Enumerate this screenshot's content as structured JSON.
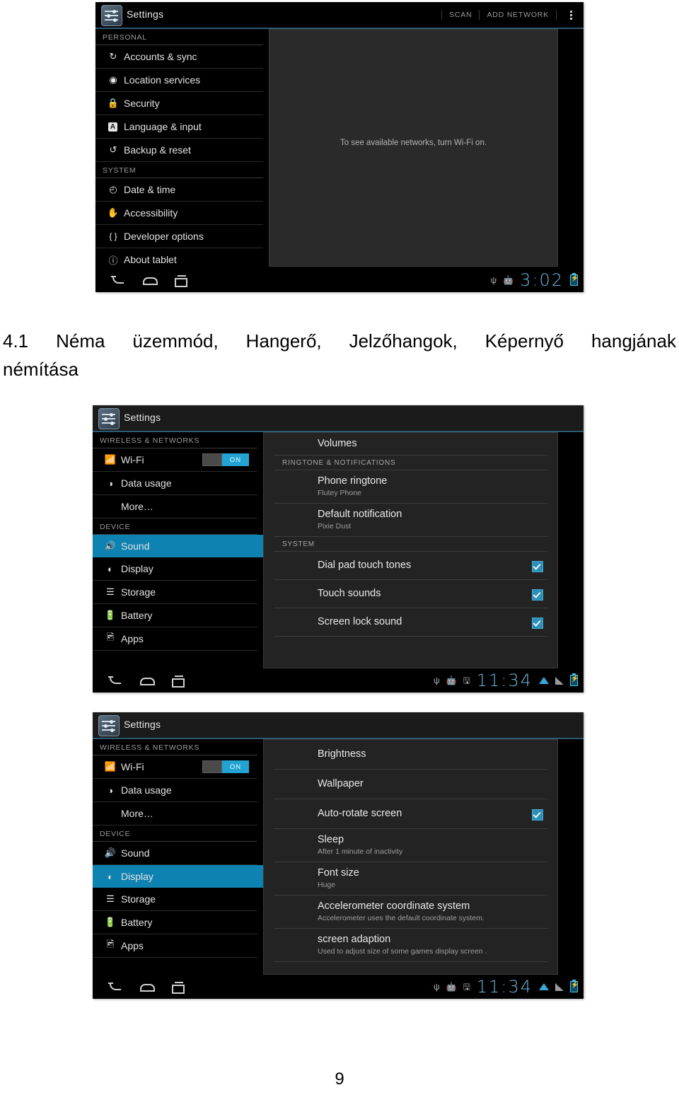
{
  "document": {
    "heading_number": "4.1",
    "heading_words": [
      "Néma",
      "üzemmód,",
      "Hangerő,",
      "Jelzőhangok,",
      "Képernyő",
      "hangjának"
    ],
    "heading_line2": "némítása",
    "page_number": "9"
  },
  "colors": {
    "accent_blue": "#0e82b0",
    "toggle_on": "#22a3d2",
    "checkbox": "#2d8fb8",
    "clock": "#6fb6d8",
    "screen_bg": "#000000",
    "panel_bg": "#232323"
  },
  "screenshot1": {
    "app_title": "Settings",
    "actions": [
      "SCAN",
      "ADD NETWORK"
    ],
    "overflow_icon": "kebab-menu-icon",
    "sidebar": [
      {
        "type": "group",
        "label": "PERSONAL"
      },
      {
        "type": "item",
        "label": "Accounts & sync",
        "icon": "sync-icon",
        "glyph": "↻"
      },
      {
        "type": "item",
        "label": "Location services",
        "icon": "location-icon",
        "glyph": "◉"
      },
      {
        "type": "item",
        "label": "Security",
        "icon": "lock-icon",
        "glyph": "ὑ2"
      },
      {
        "type": "item",
        "label": "Language & input",
        "icon": "language-icon",
        "glyph": "A"
      },
      {
        "type": "item",
        "label": "Backup & reset",
        "icon": "backup-reset-icon",
        "glyph": "↺"
      },
      {
        "type": "group",
        "label": "SYSTEM"
      },
      {
        "type": "item",
        "label": "Date & time",
        "icon": "clock-icon",
        "glyph": "◴"
      },
      {
        "type": "item",
        "label": "Accessibility",
        "icon": "hand-icon",
        "glyph": "✋"
      },
      {
        "type": "item",
        "label": "Developer options",
        "icon": "braces-icon",
        "glyph": "{ }"
      },
      {
        "type": "item",
        "label": "About tablet",
        "icon": "info-icon",
        "glyph": "ⓘ"
      }
    ],
    "content_message": "To see available networks, turn Wi-Fi on.",
    "navbar": {
      "back": "back-icon",
      "home": "home-icon",
      "recents": "recents-icon",
      "usb": "usb-icon",
      "android": "android-debug-icon",
      "clock": "3:02",
      "battery": "battery-charging-icon"
    }
  },
  "screenshot2": {
    "app_title": "Settings",
    "sidebar": [
      {
        "type": "group",
        "label": "WIRELESS & NETWORKS"
      },
      {
        "type": "item",
        "label": "Wi-Fi",
        "icon": "wifi-icon",
        "glyph": "▲",
        "toggle": "ON"
      },
      {
        "type": "item",
        "label": "Data usage",
        "icon": "data-usage-icon",
        "glyph": "◑"
      },
      {
        "type": "item",
        "label": "More…",
        "icon": "",
        "glyph": ""
      },
      {
        "type": "group",
        "label": "DEVICE"
      },
      {
        "type": "item",
        "label": "Sound",
        "icon": "speaker-icon",
        "glyph": "ὐA",
        "selected": true
      },
      {
        "type": "item",
        "label": "Display",
        "icon": "brightness-icon",
        "glyph": "◐"
      },
      {
        "type": "item",
        "label": "Storage",
        "icon": "storage-icon",
        "glyph": "☰"
      },
      {
        "type": "item",
        "label": "Battery",
        "icon": "battery-icon",
        "glyph": "ὐB"
      },
      {
        "type": "item",
        "label": "Apps",
        "icon": "apps-image-icon",
        "glyph": "ὛB"
      }
    ],
    "panel": [
      {
        "type": "row",
        "title": "Volumes"
      },
      {
        "type": "group",
        "label": "RINGTONE & NOTIFICATIONS"
      },
      {
        "type": "row",
        "title": "Phone ringtone",
        "subtitle": "Flutey Phone"
      },
      {
        "type": "row",
        "title": "Default notification",
        "subtitle": "Pixie Dust"
      },
      {
        "type": "group",
        "label": "SYSTEM"
      },
      {
        "type": "row",
        "title": "Dial pad touch tones",
        "checked": true
      },
      {
        "type": "row",
        "title": "Touch sounds",
        "checked": true
      },
      {
        "type": "row",
        "title": "Screen lock sound",
        "checked": true
      }
    ],
    "navbar": {
      "back": "back-icon",
      "home": "home-icon",
      "recents": "recents-icon",
      "usb": "usb-icon",
      "android": "android-debug-icon",
      "sdcard": "sdcard-icon",
      "clock": "11:34",
      "wifi": "wifi-signal-icon",
      "signal": "cell-signal-icon",
      "battery": "battery-charging-icon"
    }
  },
  "screenshot3": {
    "app_title": "Settings",
    "sidebar": [
      {
        "type": "group",
        "label": "WIRELESS & NETWORKS"
      },
      {
        "type": "item",
        "label": "Wi-Fi",
        "icon": "wifi-icon",
        "glyph": "▲",
        "toggle": "ON"
      },
      {
        "type": "item",
        "label": "Data usage",
        "icon": "data-usage-icon",
        "glyph": "◑"
      },
      {
        "type": "item",
        "label": "More…",
        "icon": "",
        "glyph": ""
      },
      {
        "type": "group",
        "label": "DEVICE"
      },
      {
        "type": "item",
        "label": "Sound",
        "icon": "speaker-icon",
        "glyph": "ὐA"
      },
      {
        "type": "item",
        "label": "Display",
        "icon": "brightness-icon",
        "glyph": "◐",
        "selected": true
      },
      {
        "type": "item",
        "label": "Storage",
        "icon": "storage-icon",
        "glyph": "☰"
      },
      {
        "type": "item",
        "label": "Battery",
        "icon": "battery-icon",
        "glyph": "ὐB"
      },
      {
        "type": "item",
        "label": "Apps",
        "icon": "apps-image-icon",
        "glyph": "ὛB"
      }
    ],
    "panel": [
      {
        "type": "row",
        "title": "Brightness"
      },
      {
        "type": "row",
        "title": "Wallpaper"
      },
      {
        "type": "row",
        "title": "Auto-rotate screen",
        "checked": true
      },
      {
        "type": "row",
        "title": "Sleep",
        "subtitle": "After 1 minute of inactivity"
      },
      {
        "type": "row",
        "title": "Font size",
        "subtitle": "Huge"
      },
      {
        "type": "row",
        "title": "Accelerometer coordinate system",
        "subtitle": "Accelerometer uses the default coordinate system."
      },
      {
        "type": "row",
        "title": "screen adaption",
        "subtitle": "Used to adjust size of some games display screen ."
      }
    ],
    "navbar": {
      "back": "back-icon",
      "home": "home-icon",
      "recents": "recents-icon",
      "usb": "usb-icon",
      "android": "android-debug-icon",
      "sdcard": "sdcard-icon",
      "clock": "11:34",
      "wifi": "wifi-signal-icon",
      "signal": "cell-signal-icon",
      "battery": "battery-charging-icon"
    }
  }
}
